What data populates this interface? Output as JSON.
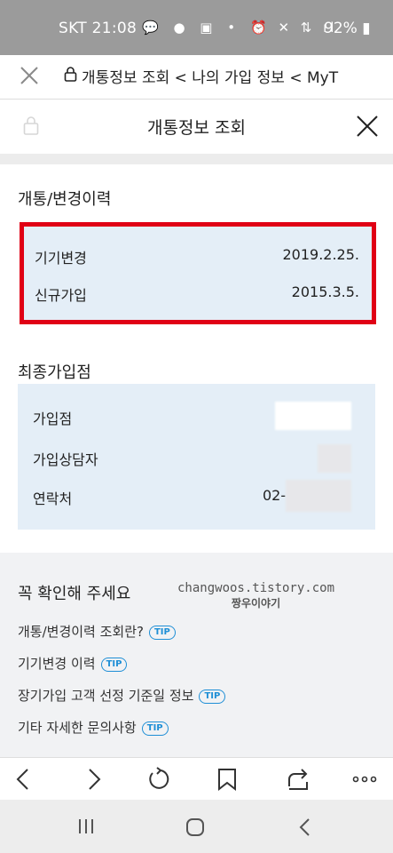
{
  "status_bar": {
    "carrier": "SKT",
    "time": "21:08",
    "battery": "92%"
  },
  "browser": {
    "url_title": "개통정보 조회 < 나의 가입 정보 < MyT"
  },
  "header": {
    "title": "개통정보 조회"
  },
  "history_section": {
    "title": "개통/변경이력",
    "rows": [
      {
        "label": "기기변경",
        "value": "2019.2.25."
      },
      {
        "label": "신규가입",
        "value": "2015.3.5."
      }
    ]
  },
  "store_section": {
    "title": "최종가입점",
    "rows": [
      {
        "label": "가입점",
        "value": ""
      },
      {
        "label": "가입상담자",
        "value": ""
      },
      {
        "label": "연락처",
        "value": "02-"
      }
    ]
  },
  "notice_section": {
    "title": "꼭 확인해 주세요",
    "items": [
      {
        "label": "개통/변경이력 조회란?",
        "tip": "TIP"
      },
      {
        "label": "기기변경 이력",
        "tip": "TIP"
      },
      {
        "label": "장기가입 고객 선정 기준일 정보",
        "tip": "TIP"
      },
      {
        "label": "기타 자세한 문의사항",
        "tip": "TIP"
      }
    ]
  },
  "watermark": {
    "line1": "changwoos.tistory.com",
    "line2": "짱우이야기"
  },
  "colors": {
    "highlight_border": "#e00015",
    "info_box_bg": "#e4eef7",
    "tip_blue": "#1f8fd6",
    "status_bar_bg": "#9b9b9b"
  }
}
